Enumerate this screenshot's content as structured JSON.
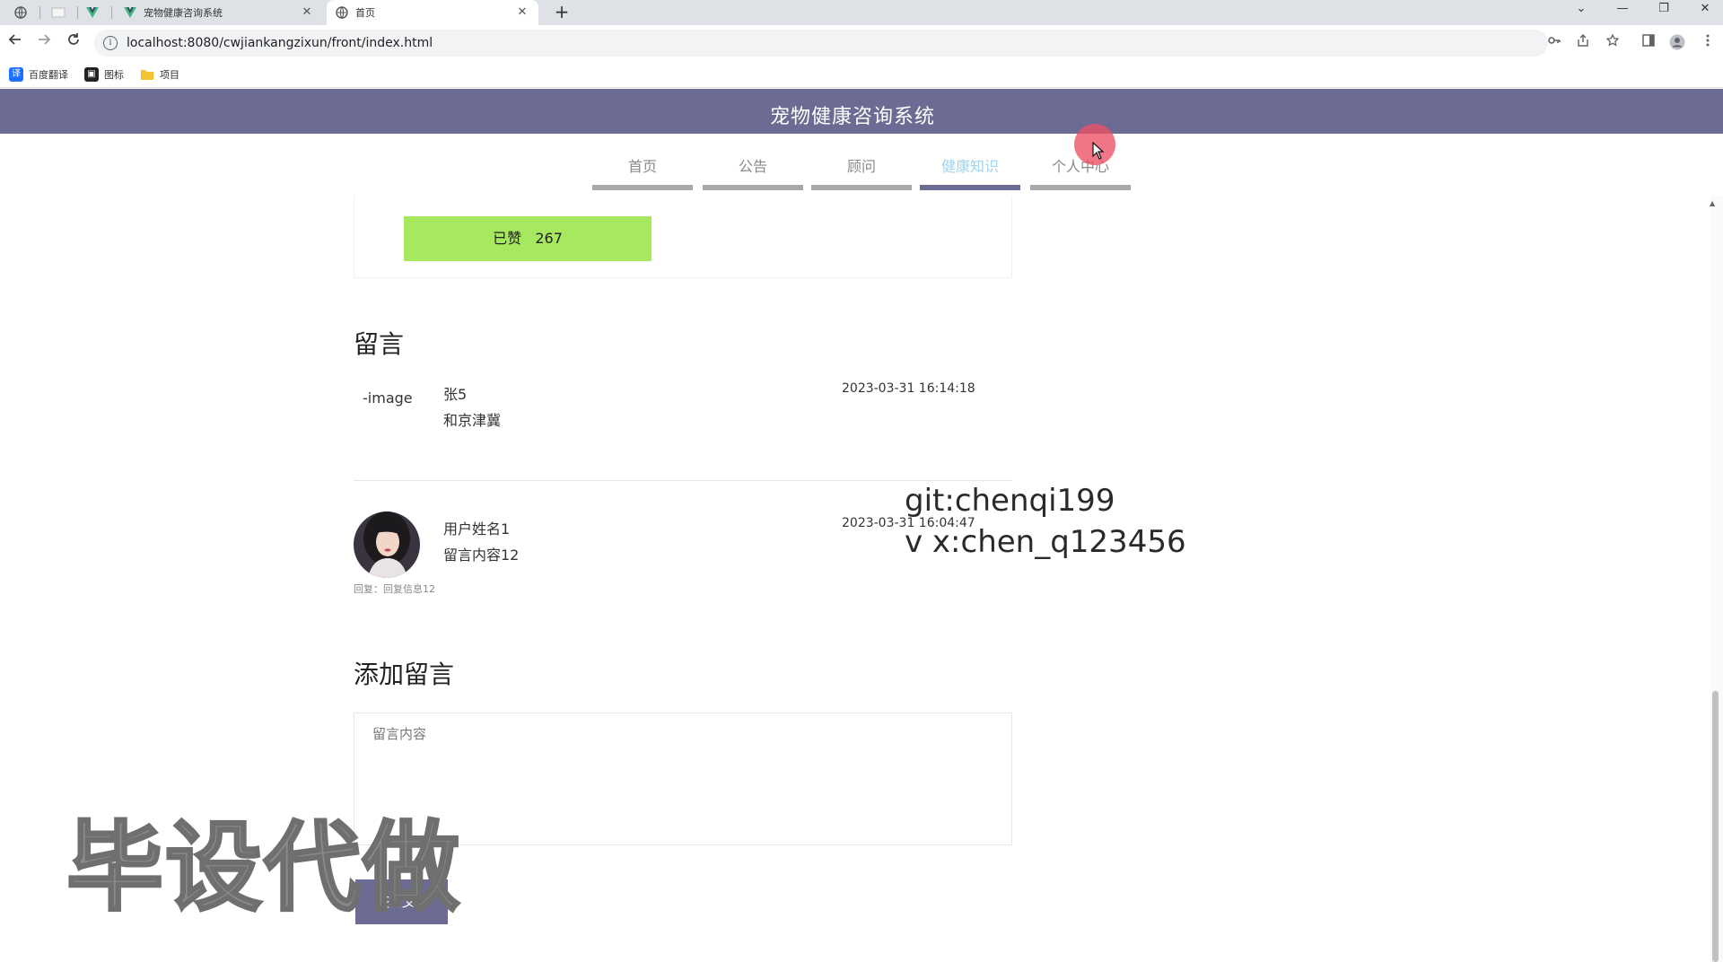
{
  "browser": {
    "tabs": [
      {
        "title": "宠物健康咨询系统",
        "close": "✕"
      },
      {
        "title": "首页",
        "close": "✕"
      }
    ],
    "new_tab": "+",
    "window_controls": {
      "minimize": "—",
      "restore": "❐",
      "close": "✕",
      "tab_search": "⌄"
    },
    "url": "localhost:8080/cwjiankangzixun/front/index.html",
    "bookmarks": [
      {
        "label": "百度翻译",
        "icon": "translate-icon",
        "color": "#1e6fff"
      },
      {
        "label": "图标",
        "icon": "image-icon",
        "color": "#222222"
      },
      {
        "label": "项目",
        "icon": "folder-icon",
        "color": "#f4c430"
      }
    ]
  },
  "site": {
    "title": "宠物健康咨询系统",
    "header_color": "#6c6b94",
    "nav": [
      {
        "label": "首页",
        "active": false
      },
      {
        "label": "公告",
        "active": false
      },
      {
        "label": "顾问",
        "active": false
      },
      {
        "label": "健康知识",
        "active": true
      },
      {
        "label": "个人中心",
        "active": false
      }
    ]
  },
  "like": {
    "label": "已赞",
    "count": "267",
    "color": "#a6e85e"
  },
  "comments_section": {
    "title": "留言",
    "items": [
      {
        "avatar_alt": "image",
        "name": "张5",
        "content": "和京津冀",
        "time": "2023-03-31 16:14:18",
        "reply": ""
      },
      {
        "avatar_alt": "avatar",
        "name": "用户姓名1",
        "content": "留言内容12",
        "time": "2023-03-31 16:04:47",
        "reply": "回复：回复信息12"
      }
    ]
  },
  "add_comment": {
    "title": "添加留言",
    "placeholder": "留言内容",
    "submit_label": "提交"
  },
  "overlays": {
    "git": "git:chenqi199",
    "wx": "v x:chen_q123456",
    "watermark": "毕设代做"
  }
}
